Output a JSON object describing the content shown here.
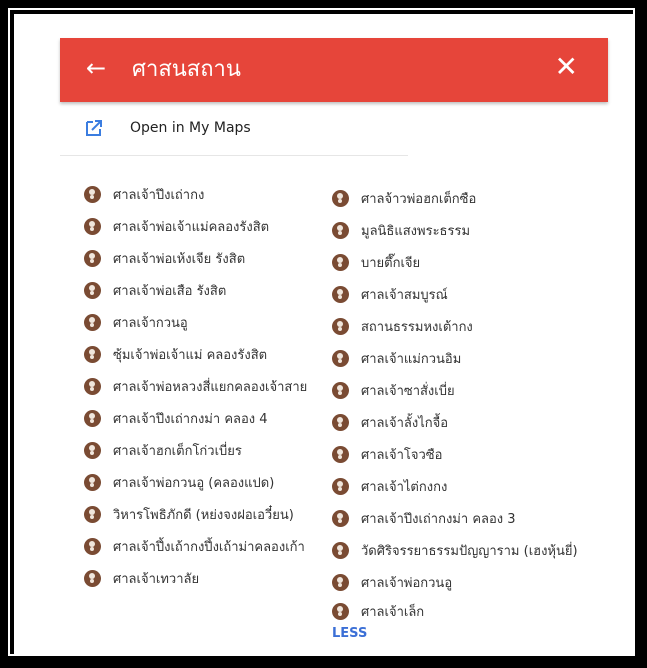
{
  "header": {
    "back_icon": "arrow-left-icon",
    "title": "ศาสนสถาน",
    "close_icon": "close-icon",
    "color": "#e6453a"
  },
  "open_maps": {
    "icon": "external-link-icon",
    "label": "Open in My Maps"
  },
  "left_items": [
    "ศาลเจ้าปึงเถ่ากง",
    "ศาลเจ้าพ่อเจ้าแม่คลองรังสิต",
    "ศาลเจ้าพ่อเห้งเจีย รังสิต",
    "ศาลเจ้าพ่อเสือ รังสิต",
    "ศาลเจ้ากวนอู",
    "ซุ้มเจ้าพ่อเจ้าแม่ คลองรังสิต",
    "ศาลเจ้าพ่อหลวงสี่แยกคลองเจ้าสาย",
    "ศาลเจ้าปึงเถ่ากงม่า คลอง 4",
    "ศาลเจ้าฮกเต็กโก่วเบี่ยร",
    "ศาลเจ้าพ่อกวนอู (คลองแปด)",
    "วิหารโพธิภักดี (หย่งจงฝอเอวี๋ยน)",
    "ศาลเจ้าปึ้งเถ้ากงปึ้งเถ้าม่าคลองเก้า",
    "ศาลเจ้าเทวาลัย"
  ],
  "right_items": [
    "ศาลจ้าวพ่อฮกเต็กซือ",
    "มูลนิธิแสงพระธรรม",
    "บายตึ๊กเจีย",
    "ศาลเจ้าสมบูรณ์",
    "สถานธรรมหงเต้ากง",
    "ศาลเจ้าแม่กวนอิม",
    "ศาลเจ้าซาสั่งเบี่ย",
    "ศาลเจ้าลั้งไกจื้อ",
    "ศาลเจ้าโจวซือ",
    "ศาลเจ้าไต่กงกง",
    "ศาลเจ้าปึงเถ่ากงม่า คลอง 3",
    "วัดศิริจรรยาธรรมปัญญาราม (เฮงหุ้นยี่)",
    "ศาลเจ้าพ่อกวนอู",
    "ศาลเจ้าเล็ก"
  ],
  "pin_icon": "temple-pin-icon",
  "pin_color": "#7a4b33",
  "less_label": "LESS",
  "less_color": "#3b6fd6"
}
